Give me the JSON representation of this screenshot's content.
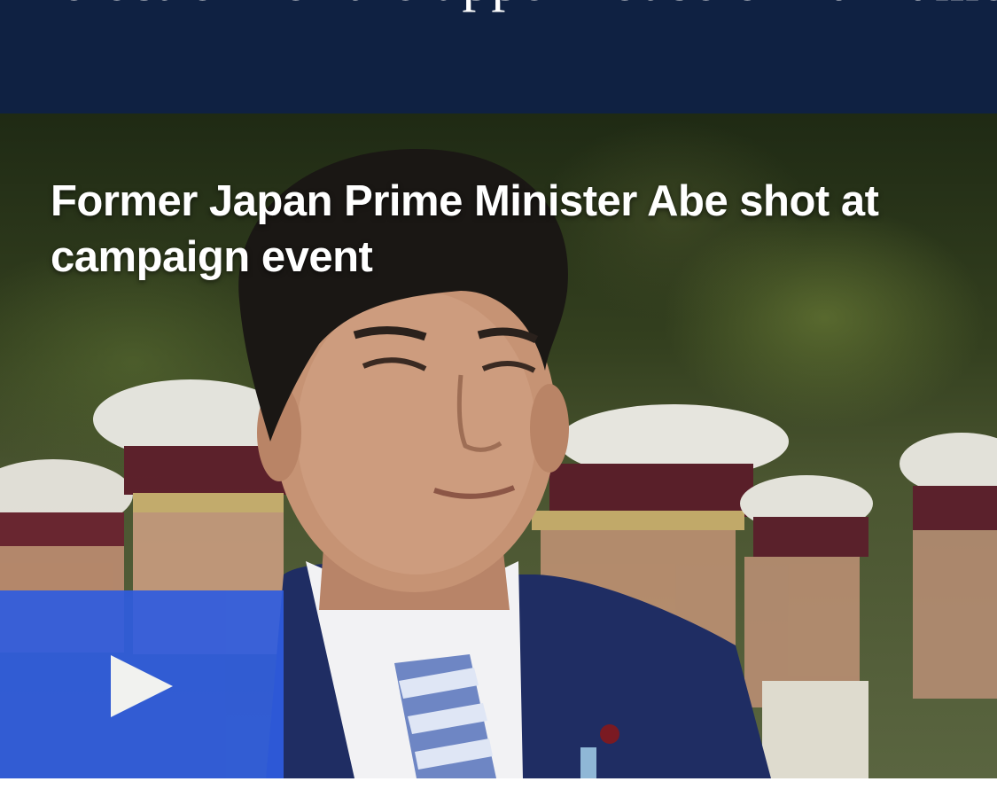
{
  "banner": {
    "text": "election for the upper house of Parliament."
  },
  "video": {
    "headline": "Former Japan Prime Minister Abe shot at campaign event",
    "play_icon": "play-icon",
    "play_button_color": "#2f5ce0"
  },
  "colors": {
    "banner_background": "#0f2142",
    "headline_text": "#ffffff"
  }
}
